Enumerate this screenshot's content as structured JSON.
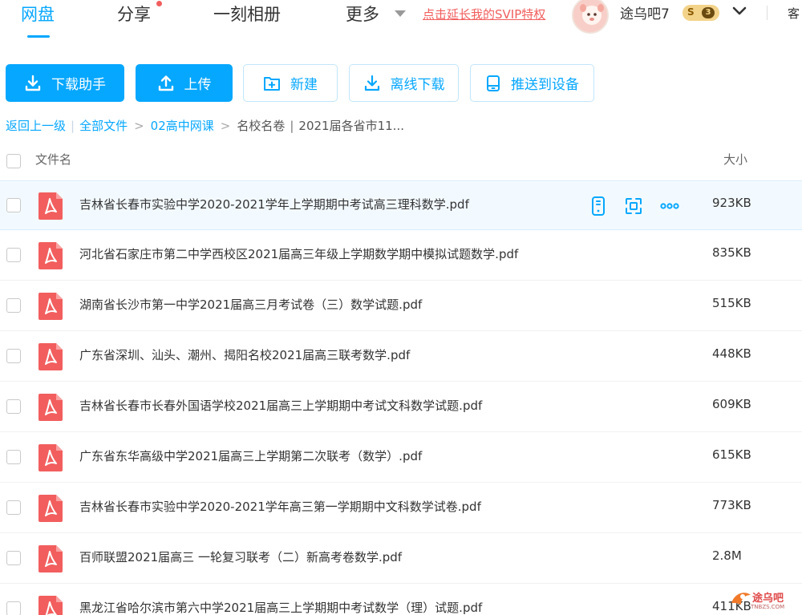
{
  "nav": {
    "items": [
      "网盘",
      "分享",
      "一刻相册",
      "更多"
    ],
    "svip_link": "点击延长我的SVIP特权",
    "username": "途乌吧7",
    "badge_s": "S",
    "badge_level": "3",
    "truncated": "客"
  },
  "toolbar": {
    "download_helper": "下载助手",
    "upload": "上传",
    "new": "新建",
    "offline_download": "离线下载",
    "push_device": "推送到设备"
  },
  "breadcrumb": {
    "back": "返回上一级",
    "all_files": "全部文件",
    "folder1": "02高中网课",
    "folder2": "名校名卷",
    "current": "2021届各省市11..."
  },
  "list": {
    "col_name": "文件名",
    "col_size": "大小",
    "files": [
      {
        "name": "吉林省长春市实验中学2020-2021学年上学期期中考试高三理科数学.pdf",
        "size": "923KB"
      },
      {
        "name": "河北省石家庄市第二中学西校区2021届高三年级上学期数学期中模拟试题数学.pdf",
        "size": "835KB"
      },
      {
        "name": "湖南省长沙市第一中学2021届高三月考试卷（三）数学试题.pdf",
        "size": "515KB"
      },
      {
        "name": "广东省深圳、汕头、潮州、揭阳名校2021届高三联考数学.pdf",
        "size": "448KB"
      },
      {
        "name": "吉林省长春市长春外国语学校2021届高三上学期期中考试文科数学试题.pdf",
        "size": "609KB"
      },
      {
        "name": "广东省东华高级中学2021届高三上学期第二次联考（数学）.pdf",
        "size": "615KB"
      },
      {
        "name": "吉林省长春市实验中学2020-2021学年高三第一学期期中文科数学试卷.pdf",
        "size": "773KB"
      },
      {
        "name": "百师联盟2021届高三 一轮复习联考（二）新高考卷数学.pdf",
        "size": "2.8M"
      },
      {
        "name": "黑龙江省哈尔滨市第六中学2021届高三上学期期中考试数学（理）试题.pdf",
        "size": "411KB"
      }
    ]
  },
  "watermark": {
    "text": "途乌吧",
    "sub": "TNBZS.COM"
  },
  "colors": {
    "accent": "#06a7ff",
    "pdf": "#f25e5e",
    "svip": "#f25e5e"
  }
}
